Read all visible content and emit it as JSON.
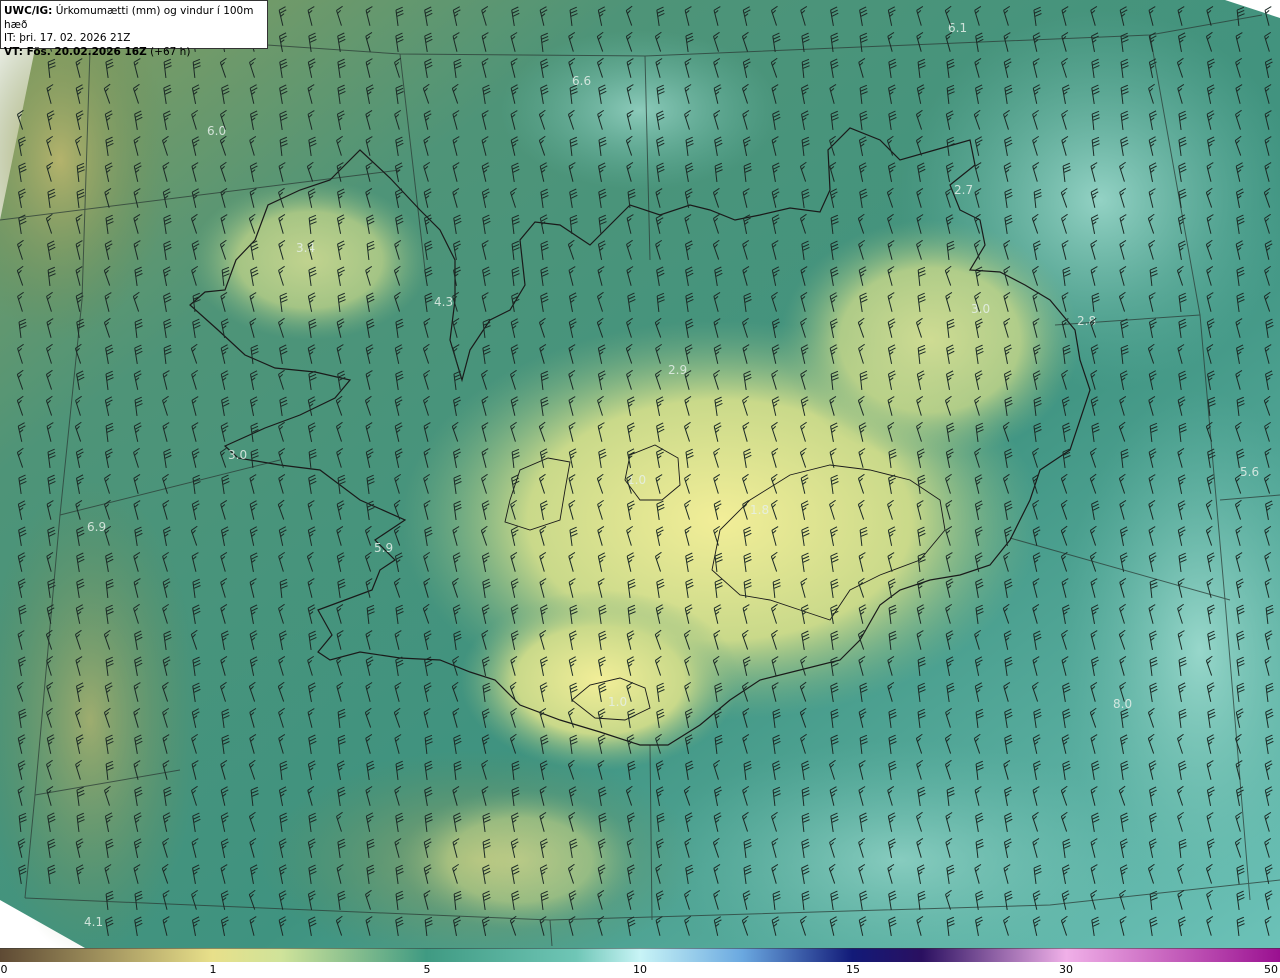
{
  "header": {
    "model": "UWC/IG:",
    "field": "Úrkomumætti (mm) og vindur í 100m hæð",
    "issue_time": "IT: þri. 17. 02. 2026 21Z",
    "valid_prefix": "VT: Fös. 20.02.2026 16Z",
    "valid_suffix": "(+67 h)"
  },
  "colorbar": {
    "ticks": [
      "0",
      "1",
      "5",
      "10",
      "15",
      "30",
      "50"
    ],
    "colors": [
      "#5e4a34",
      "#a89060",
      "#f0e890",
      "#8fd0a0",
      "#3fa090",
      "#9ff0f0",
      "#1f2fa0",
      "#0a0a60",
      "#e090e0",
      "#a01090"
    ]
  },
  "map_values": [
    "6.1",
    "6.6",
    "6.0",
    "3.4",
    "4.3",
    "2.7",
    "3.0",
    "2.8",
    "2.9",
    "3.0",
    "5.6",
    "1.0",
    "6.9",
    "5.9",
    "1.8",
    "1.0",
    "8.0",
    "4.1"
  ],
  "colors": {
    "ocean_teal": "#3e8f78",
    "land_yellow": "#e6e48e",
    "glacier_yellow": "#f2ee9a",
    "olive_west": "#6d8a52",
    "light_aqua": "#8fd3c4",
    "coastline": "#1a1a1a"
  }
}
